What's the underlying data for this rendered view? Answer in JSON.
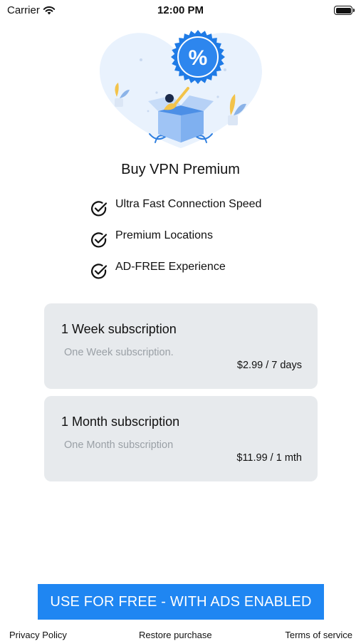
{
  "status_bar": {
    "carrier": "Carrier",
    "time": "12:00 PM",
    "wifi_icon": "wifi-icon",
    "battery_icon": "battery-icon"
  },
  "hero": {
    "illustration": "gift-box-discount-illustration",
    "badge_symbol": "%",
    "badge_color": "#1f7be6",
    "backdrop_color": "#e9f2fd"
  },
  "title": "Buy VPN Premium",
  "features": [
    {
      "label": "Ultra Fast Connection Speed",
      "icon": "check-circle-icon"
    },
    {
      "label": "Premium Locations",
      "icon": "check-circle-icon"
    },
    {
      "label": "AD-FREE Experience",
      "icon": "check-circle-icon"
    }
  ],
  "subscriptions": [
    {
      "title": "1 Week subscription",
      "description": "One Week subscription.",
      "price": "$2.99 / 7 days"
    },
    {
      "title": "1 Month subscription",
      "description": "One Month subscription",
      "price": "$11.99 / 1 mth"
    }
  ],
  "cta": {
    "label": "USE FOR FREE - WITH ADS ENABLED",
    "color": "#1f86f2"
  },
  "footer": {
    "privacy": "Privacy Policy",
    "restore": "Restore purchase",
    "terms": "Terms of service"
  },
  "colors": {
    "card_bg": "#e7eaed",
    "muted_text": "#9aa0a6",
    "accent": "#1f86f2"
  }
}
